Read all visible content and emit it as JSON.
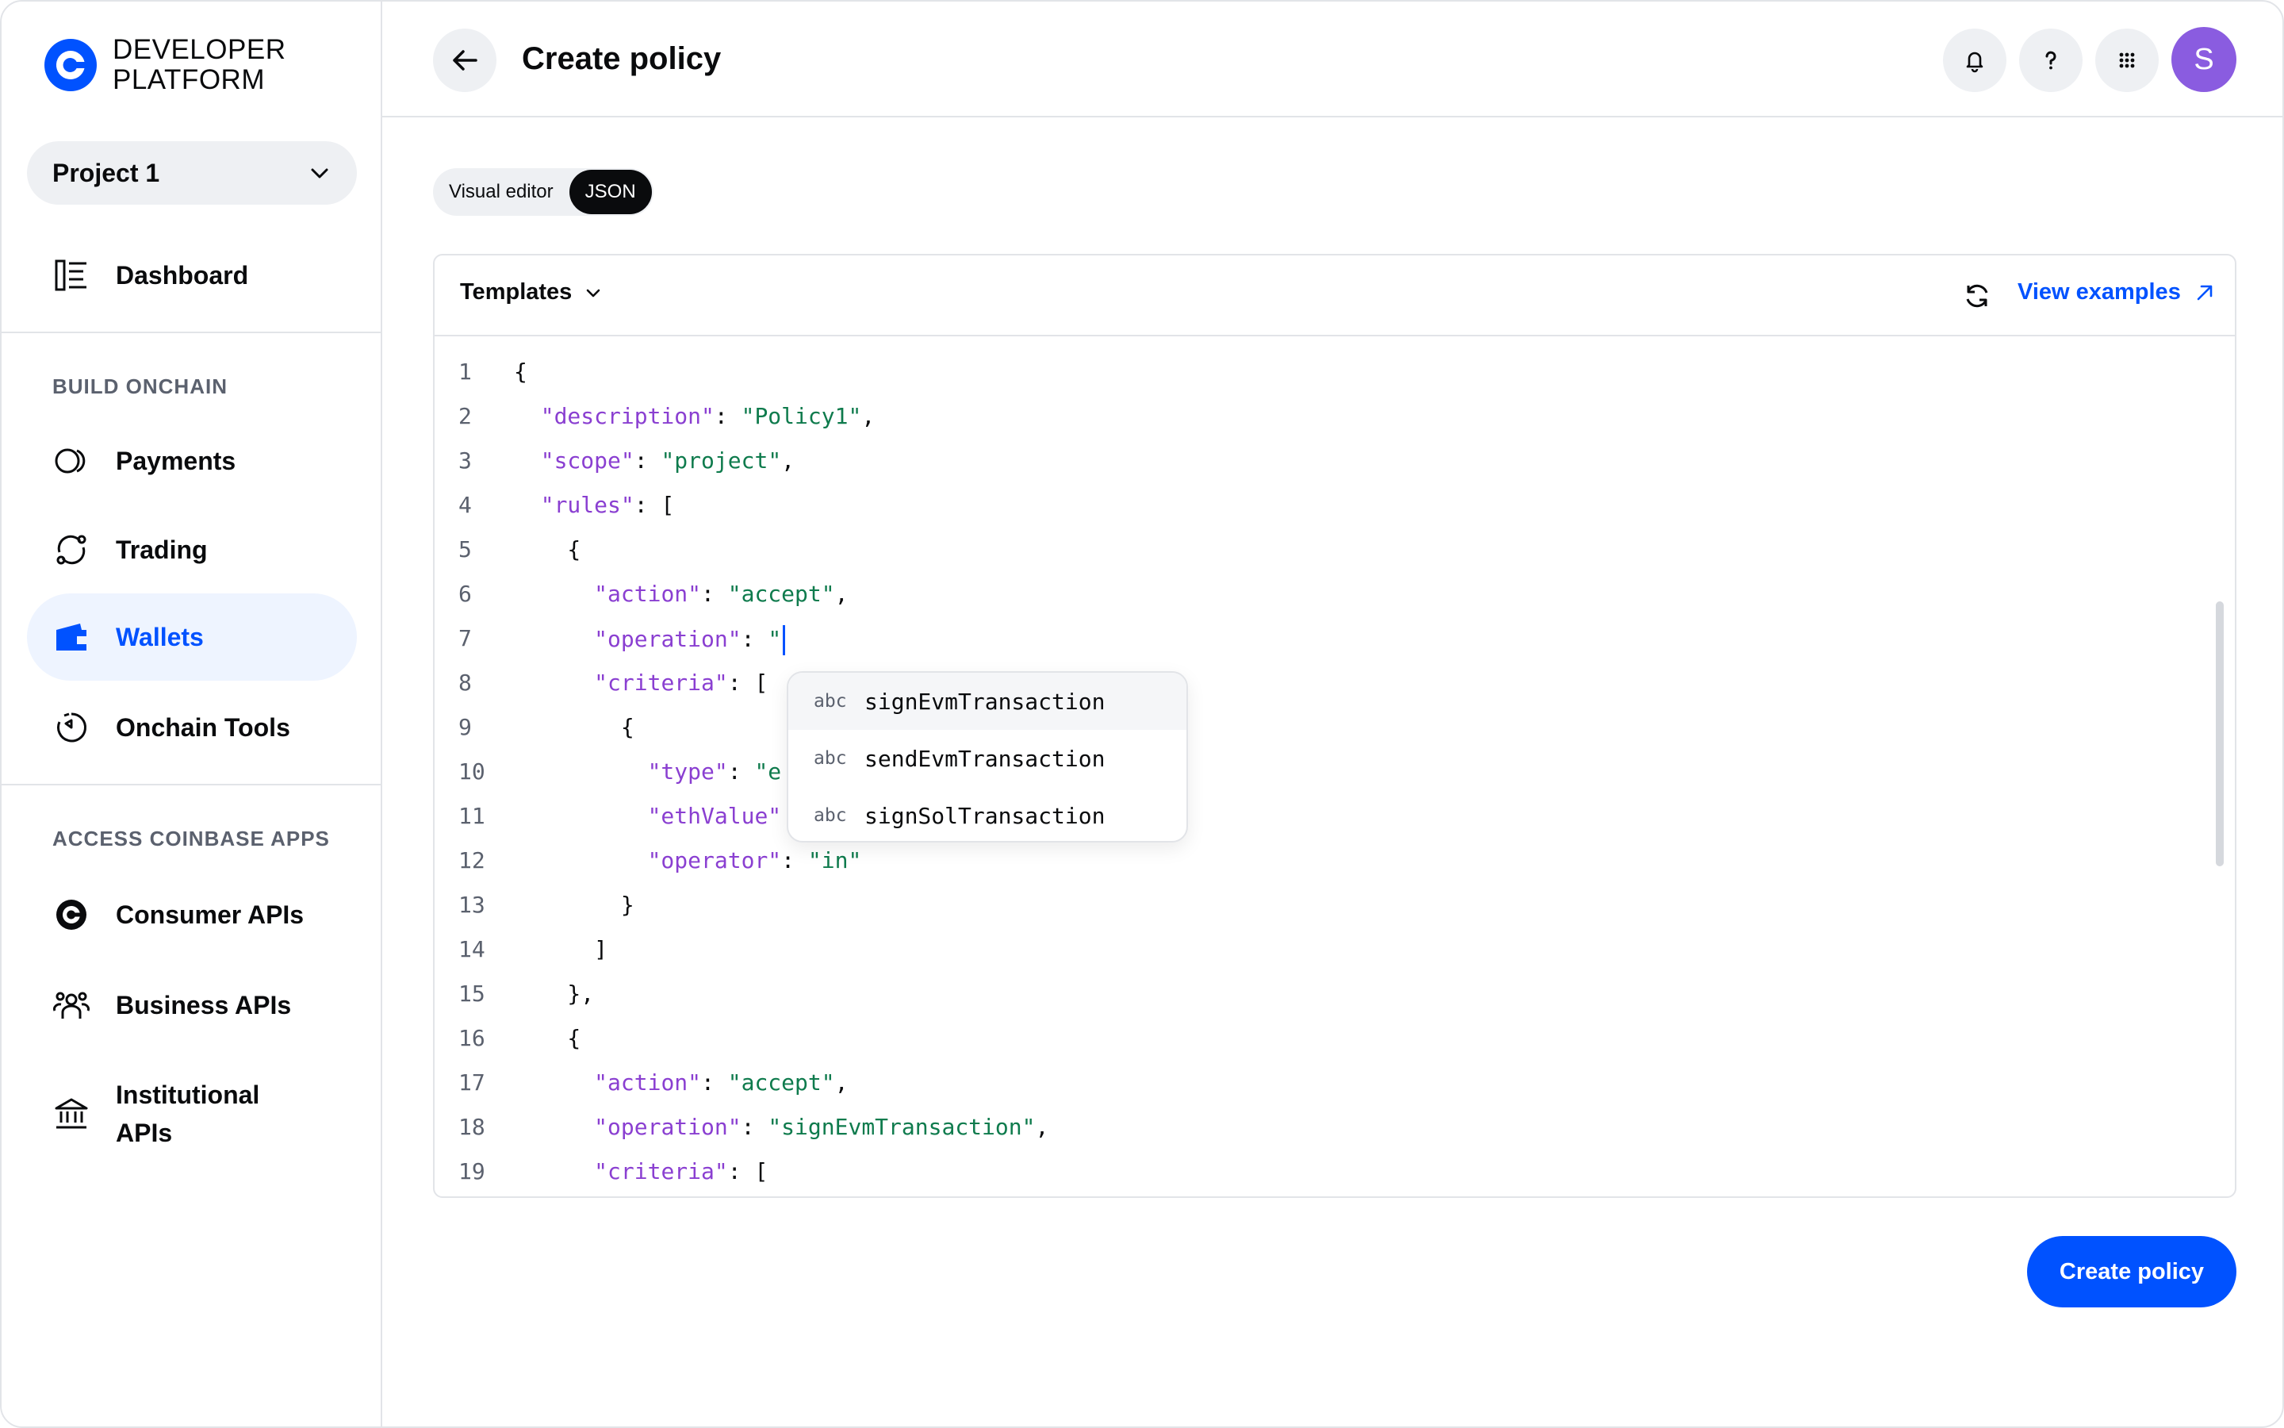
{
  "brand": {
    "line1": "DEVELOPER",
    "line2": "PLATFORM",
    "color": "#0052ff"
  },
  "project": {
    "selected": "Project 1"
  },
  "sidebar": {
    "top_items": [
      {
        "label": "Dashboard",
        "icon": "dashboard-icon"
      }
    ],
    "sections": [
      {
        "title": "BUILD ONCHAIN",
        "items": [
          {
            "label": "Payments",
            "icon": "payments-icon"
          },
          {
            "label": "Trading",
            "icon": "trading-icon"
          },
          {
            "label": "Wallets",
            "icon": "wallet-icon",
            "active": true
          },
          {
            "label": "Onchain Tools",
            "icon": "onchain-tools-icon"
          }
        ]
      },
      {
        "title": "ACCESS COINBASE APPS",
        "items": [
          {
            "label": "Consumer APIs",
            "icon": "coinbase-icon"
          },
          {
            "label": "Business APIs",
            "icon": "people-icon"
          },
          {
            "label": "Institutional APIs",
            "icon": "bank-icon"
          }
        ]
      }
    ]
  },
  "header": {
    "title": "Create policy",
    "avatar_initial": "S",
    "avatar_color": "#8a5ce0"
  },
  "editor": {
    "modes": [
      "Visual editor",
      "JSON"
    ],
    "active_mode": "JSON",
    "templates_label": "Templates",
    "view_examples_label": "View examples",
    "lines": [
      {
        "n": "1",
        "parts": [
          [
            "p",
            "{"
          ]
        ]
      },
      {
        "n": "2",
        "parts": [
          [
            "p",
            "  "
          ],
          [
            "k",
            "\"description\""
          ],
          [
            "p",
            ": "
          ],
          [
            "s",
            "\"Policy1\""
          ],
          [
            "p",
            ","
          ]
        ]
      },
      {
        "n": "3",
        "parts": [
          [
            "p",
            "  "
          ],
          [
            "k",
            "\"scope\""
          ],
          [
            "p",
            ": "
          ],
          [
            "s",
            "\"project\""
          ],
          [
            "p",
            ","
          ]
        ]
      },
      {
        "n": "4",
        "parts": [
          [
            "p",
            "  "
          ],
          [
            "k",
            "\"rules\""
          ],
          [
            "p",
            ": ["
          ]
        ]
      },
      {
        "n": "5",
        "parts": [
          [
            "p",
            "    {"
          ]
        ]
      },
      {
        "n": "6",
        "parts": [
          [
            "p",
            "      "
          ],
          [
            "k",
            "\"action\""
          ],
          [
            "p",
            ": "
          ],
          [
            "s",
            "\"accept\""
          ],
          [
            "p",
            ","
          ]
        ]
      },
      {
        "n": "7",
        "parts": [
          [
            "p",
            "      "
          ],
          [
            "k",
            "\"operation\""
          ],
          [
            "p",
            ": "
          ],
          [
            "s",
            "\""
          ]
        ],
        "cursor": true
      },
      {
        "n": "8",
        "parts": [
          [
            "p",
            "      "
          ],
          [
            "k",
            "\"criteria\""
          ],
          [
            "p",
            ": ["
          ]
        ]
      },
      {
        "n": "9",
        "parts": [
          [
            "p",
            "        {"
          ]
        ]
      },
      {
        "n": "10",
        "parts": [
          [
            "p",
            "          "
          ],
          [
            "k",
            "\"type\""
          ],
          [
            "p",
            ": "
          ],
          [
            "s",
            "\"e"
          ]
        ]
      },
      {
        "n": "11",
        "parts": [
          [
            "p",
            "          "
          ],
          [
            "k",
            "\"ethValue\""
          ]
        ]
      },
      {
        "n": "12",
        "parts": [
          [
            "p",
            "          "
          ],
          [
            "k",
            "\"operator\""
          ],
          [
            "p",
            ": "
          ],
          [
            "s",
            "\"in\""
          ]
        ]
      },
      {
        "n": "13",
        "parts": [
          [
            "p",
            "        }"
          ]
        ]
      },
      {
        "n": "14",
        "parts": [
          [
            "p",
            "      ]"
          ]
        ]
      },
      {
        "n": "15",
        "parts": [
          [
            "p",
            "    },"
          ]
        ]
      },
      {
        "n": "16",
        "parts": [
          [
            "p",
            "    {"
          ]
        ]
      },
      {
        "n": "17",
        "parts": [
          [
            "p",
            "      "
          ],
          [
            "k",
            "\"action\""
          ],
          [
            "p",
            ": "
          ],
          [
            "s",
            "\"accept\""
          ],
          [
            "p",
            ","
          ]
        ]
      },
      {
        "n": "18",
        "parts": [
          [
            "p",
            "      "
          ],
          [
            "k",
            "\"operation\""
          ],
          [
            "p",
            ": "
          ],
          [
            "s",
            "\"signEvmTransaction\""
          ],
          [
            "p",
            ","
          ]
        ]
      },
      {
        "n": "19",
        "parts": [
          [
            "p",
            "      "
          ],
          [
            "k",
            "\"criteria\""
          ],
          [
            "p",
            ": ["
          ]
        ]
      }
    ],
    "suggestions": [
      {
        "kind": "abc",
        "value": "signEvmTransaction",
        "highlighted": true
      },
      {
        "kind": "abc",
        "value": "sendEvmTransaction"
      },
      {
        "kind": "abc",
        "value": "signSolTransaction"
      }
    ]
  },
  "submit_label": "Create policy"
}
